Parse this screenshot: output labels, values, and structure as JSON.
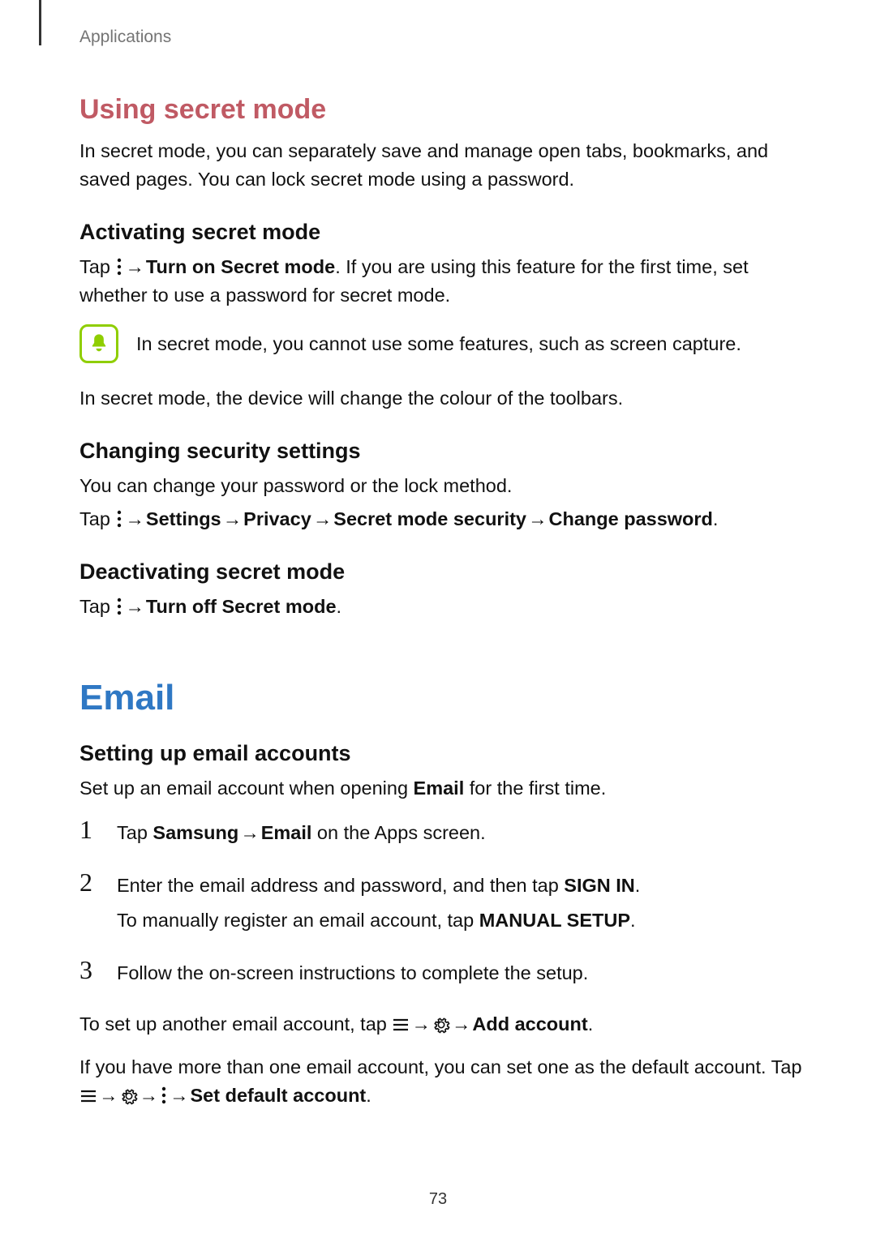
{
  "breadcrumb": "Applications",
  "section1": {
    "title": "Using secret mode",
    "intro": "In secret mode, you can separately save and manage open tabs, bookmarks, and saved pages. You can lock secret mode using a password.",
    "activating": {
      "heading": "Activating secret mode",
      "tap": "Tap ",
      "arrow": " → ",
      "boldAction": "Turn on Secret mode",
      "rest": ". If you are using this feature for the first time, set whether to use a password for secret mode.",
      "noteText": "In secret mode, you cannot use some features, such as screen capture.",
      "toolbarNote": "In secret mode, the device will change the colour of the toolbars."
    },
    "changing": {
      "heading": "Changing security settings",
      "intro": "You can change your password or the lock method.",
      "tap": "Tap ",
      "arrow": " → ",
      "settings": "Settings",
      "privacy": "Privacy",
      "sms": "Secret mode security",
      "cp": "Change password",
      "period": "."
    },
    "deactivating": {
      "heading": "Deactivating secret mode",
      "tap": "Tap ",
      "arrow": " → ",
      "boldAction": "Turn off Secret mode",
      "period": "."
    }
  },
  "chapter": {
    "title": "Email",
    "heading": "Setting up email accounts",
    "intro_a": "Set up an email account when opening ",
    "intro_bold": "Email",
    "intro_b": " for the first time.",
    "steps": {
      "n1": "1",
      "s1_a": "Tap ",
      "s1_samsung": "Samsung",
      "s1_arrow": " → ",
      "s1_email": "Email",
      "s1_b": " on the Apps screen.",
      "n2": "2",
      "s2_a": "Enter the email address and password, and then tap ",
      "s2_signin": "SIGN IN",
      "s2_period": ".",
      "s2_sub_a": "To manually register an email account, tap ",
      "s2_manual": "MANUAL SETUP",
      "s2_sub_period": ".",
      "n3": "3",
      "s3": "Follow the on-screen instructions to complete the setup."
    },
    "another_a": "To set up another email account, tap ",
    "another_arrow": " → ",
    "another_add": "Add account",
    "another_period": ".",
    "default_a": "If you have more than one email account, you can set one as the default account. Tap ",
    "default_arrow": " → ",
    "default_set": "Set default account",
    "default_period": "."
  },
  "pageNumber": "73",
  "iconNames": {
    "more": "more-options-icon",
    "bell": "bell-icon",
    "hamburger": "hamburger-menu-icon",
    "gear": "gear-icon"
  }
}
